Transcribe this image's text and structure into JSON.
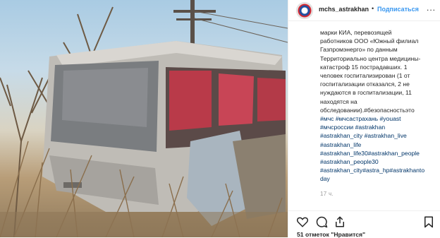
{
  "post": {
    "username": "mchs_astrakhan",
    "separator": "•",
    "follow_label": "Подписаться",
    "more_label": "...",
    "caption_lines": [
      "марки КИА, перевозящей",
      "работников ООО «Южный филиал",
      "Газпромэнерго» по данным",
      "Территориально центра медицины-",
      "катастроф 15 пострадавших. 1",
      "человек госпитализирован (1 от",
      "госпитализации отказался, 2 не",
      "нуждаются в госпитализации, 11",
      "находятся на",
      "обследовании).#безопасностьэто"
    ],
    "hashtag_lines": [
      "#мчс #мчсастрахань #youast",
      "#мчсроссии #astrakhan",
      "#astrakhan_city #astrakhan_live",
      "#astrakhan_life",
      "#astrakhan_life30#astrakhan_people",
      "#astrakhan_people30",
      "#astrakhan_city#astra_hp#astrakhanto",
      "day"
    ],
    "time_ago": "17 ч.",
    "likes_text": "51 отметок \"Нравится\""
  },
  "icons": {
    "like": "heart-icon",
    "comment": "comment-icon",
    "share": "share-icon",
    "save": "bookmark-icon",
    "more": "more-icon"
  },
  "colors": {
    "link": "#003569",
    "follow": "#3897f0",
    "text": "#262626",
    "muted": "#999999"
  }
}
